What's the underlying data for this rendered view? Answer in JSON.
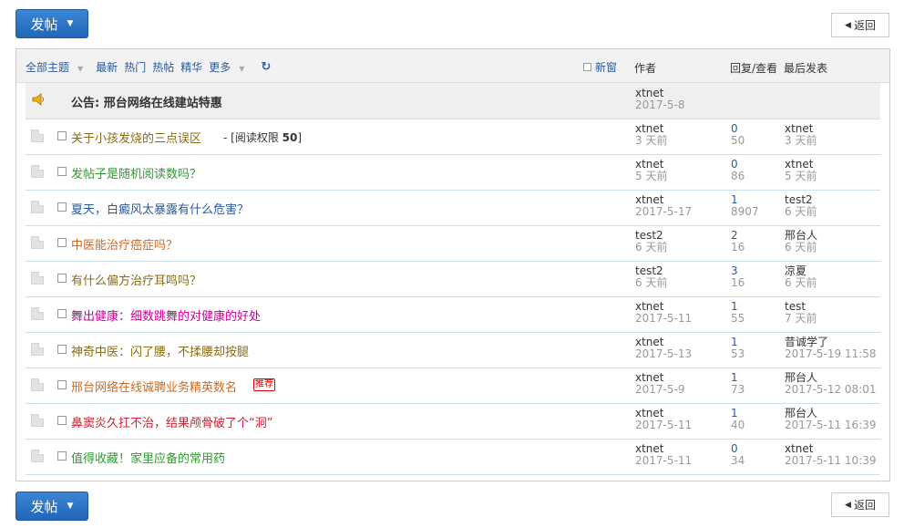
{
  "toolbar": {
    "post_label": "发帖",
    "back_label": "返回"
  },
  "header": {
    "filters": [
      "全部主题",
      "最新",
      "热门",
      "热帖",
      "精华",
      "更多"
    ],
    "new_window_label": "新窗",
    "col_author": "作者",
    "col_replies": "回复/查看",
    "col_last": "最后发表"
  },
  "announcement": {
    "title": "公告: 邢台网络在线建站特惠",
    "author": "xtnet",
    "date": "2017-5-8"
  },
  "threads": [
    {
      "title": "关于小孩发烧的三点误区",
      "color": "#8a6d1a",
      "perm": "- [阅读权限 ",
      "perm_val": "50",
      "perm_end": "]",
      "author": "xtnet",
      "date": "3 天前",
      "replies": "0",
      "views": "50",
      "last_user": "xtnet",
      "last_time": "3 天前"
    },
    {
      "title": "发帖子是随机阅读数吗？",
      "color": "#339933",
      "author": "xtnet",
      "date": "5 天前",
      "replies": "0",
      "views": "86",
      "last_user": "xtnet",
      "last_time": "5 天前"
    },
    {
      "title": "夏天，白癜风太暴露有什么危害？",
      "color": "#2b5b9b",
      "author": "xtnet",
      "date": "2017-5-17",
      "replies": "1",
      "views": "8907",
      "last_user": "test2",
      "last_time": "6 天前"
    },
    {
      "title": "中医能治疗癌症吗？",
      "color": "#d2691e",
      "author": "test2",
      "date": "6 天前",
      "replies": "2",
      "views": "16",
      "last_user": "邢台人",
      "last_time": "6 天前"
    },
    {
      "title": "有什么偏方治疗耳鸣吗？",
      "color": "#8a6d1a",
      "author": "test2",
      "date": "6 天前",
      "replies": "3",
      "views": "16",
      "last_user": "凉夏",
      "last_time": "6 天前"
    },
    {
      "title": "舞出健康：细数跳舞的对健康的好处",
      "color": "#cc0099",
      "author": "xtnet",
      "date": "2017-5-11",
      "replies": "1",
      "views": "55",
      "last_user": "test",
      "last_time": "7 天前"
    },
    {
      "title": "神奇中医：闪了腰，不揉腰却按腿",
      "color": "#8a6d1a",
      "author": "xtnet",
      "date": "2017-5-13",
      "replies": "1",
      "views": "53",
      "last_user": "昔诚学了",
      "last_time": "2017-5-19 11:58"
    },
    {
      "title": "邢台网络在线诚聘业务精英数名",
      "color": "#d2691e",
      "badge": "推荐",
      "author": "xtnet",
      "date": "2017-5-9",
      "replies": "1",
      "views": "73",
      "last_user": "邢台人",
      "last_time": "2017-5-12 08:01"
    },
    {
      "title": "鼻窦炎久扛不治，结果颅骨破了个“洞”",
      "color": "#cc2233",
      "author": "xtnet",
      "date": "2017-5-11",
      "replies": "1",
      "views": "40",
      "last_user": "邢台人",
      "last_time": "2017-5-11 16:39"
    },
    {
      "title": "值得收藏！家里应备的常用药",
      "color": "#339933",
      "author": "xtnet",
      "date": "2017-5-11",
      "replies": "0",
      "views": "34",
      "last_user": "xtnet",
      "last_time": "2017-5-11 10:39"
    }
  ]
}
